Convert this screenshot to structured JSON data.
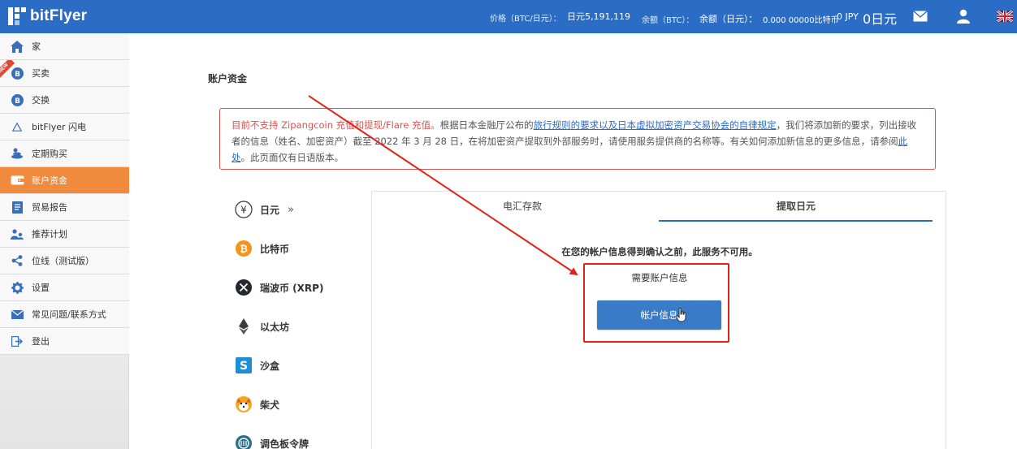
{
  "header": {
    "brand": "bitFlyer",
    "price_label": "价格（BTC/日元）：",
    "price_value": "日元5,191,119",
    "balance_btc_label": "余额（BTC）：",
    "balance_jpy_label": "余额（日元）：",
    "balance_btc_value": "0.000 00000比特币",
    "balance_jpy_value": "0 JPY",
    "balance_jpy_big": "0日元"
  },
  "sidebar": {
    "new_badge": "NEW",
    "items": [
      {
        "label": "家",
        "icon": "home-icon"
      },
      {
        "label": "买卖",
        "icon": "bitcoin-circle-icon"
      },
      {
        "label": "交换",
        "icon": "bitcoin-circle-icon"
      },
      {
        "label": "bitFlyer 闪电",
        "icon": "lightning-triangle-icon"
      },
      {
        "label": "定期购买",
        "icon": "recurring-buy-icon"
      },
      {
        "label": "账户资金",
        "icon": "wallet-icon"
      },
      {
        "label": "贸易报告",
        "icon": "report-icon"
      },
      {
        "label": "推荐计划",
        "icon": "referral-icon"
      },
      {
        "label": "位线（测试版）",
        "icon": "share-icon"
      },
      {
        "label": "设置",
        "icon": "gear-icon"
      },
      {
        "label": "常见问题/联系方式",
        "icon": "mail-icon"
      },
      {
        "label": "登出",
        "icon": "logout-icon"
      }
    ]
  },
  "main": {
    "title": "账户资金",
    "notice": {
      "red_text": "目前不支持 Zipangcoin 充值和提现/Flare 充值。",
      "text1": "根据日本金融厅公布的",
      "link1": "旅行规则的要求以及日本虚拟加密资产交易协会的自律规定",
      "text2": "，我们将添加新的要求，列出接收者的信息（姓名、加密资产）截至 2022 年 3 月 28 日，在将加密资产提取到外部服务时，请使用服务提供商的名称等。有关如何添加新信息的更多信息，请参阅",
      "link2": "此处",
      "text3": "。此页面仅有日语版本。"
    },
    "currencies": [
      {
        "label": "日元",
        "icon": "yen-icon"
      },
      {
        "label": "比特币",
        "icon": "bitcoin-icon"
      },
      {
        "label": "瑞波币 (XRP)",
        "icon": "xrp-icon"
      },
      {
        "label": "以太坊",
        "icon": "ethereum-icon"
      },
      {
        "label": "沙盒",
        "icon": "sandbox-icon"
      },
      {
        "label": "柴犬",
        "icon": "shiba-icon"
      },
      {
        "label": "调色板令牌",
        "icon": "palette-token-icon"
      }
    ],
    "currency_chevron": "»",
    "tabs": [
      {
        "label": "电汇存款"
      },
      {
        "label": "提取日元"
      }
    ],
    "service_message": "在您的帐户信息得到确认之前，此服务不可用。",
    "required_label": "需要账户信息",
    "account_button": "帐户信息"
  },
  "colors": {
    "header_blue": "#2b6cc4",
    "active_orange": "#f08a3c",
    "annotation_red": "#e0221b",
    "button_blue": "#3a7bc8"
  }
}
